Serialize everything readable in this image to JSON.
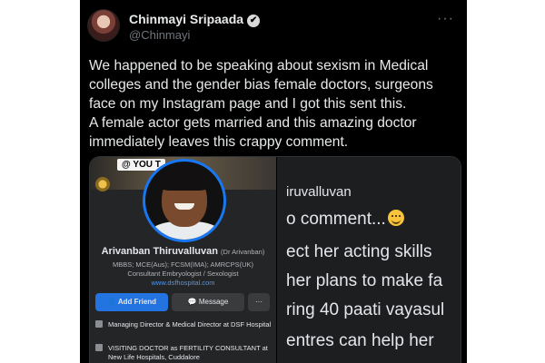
{
  "tweet": {
    "author_name": "Chinmayi Sripaada",
    "verified_badge": "✔",
    "handle": "@Chinmayi",
    "more_label": "···",
    "text": [
      "We happened to be speaking about sexism in Medical colleges and the gender bias female doctors, surgeons face on my Instagram page and I got this sent this.",
      "A female actor gets married and this amazing doctor immediately leaves this crappy comment."
    ]
  },
  "screenshot_left": {
    "tag": "@ YOU T",
    "profile_name": "Arivanban Thiruvalluvan",
    "profile_alt_name": "(Dr Arivanban)",
    "qualifications_line1": "MBBS; MCE(Aus); FCSM(IMA); AMRCPS(UK)",
    "qualifications_line2": "Consultant Embryologist / Sexologist",
    "website": "www.dsfhospital.com",
    "add_friend_label": "Add Friend",
    "message_label": "Message",
    "more_label": "···",
    "info": [
      "Managing Director & Medical Director at DSF Hospital",
      "VISITING DOCTOR as FERTILITY CONSULTANT at New Life Hospitals, Cuddalore"
    ]
  },
  "screenshot_right": {
    "lines": [
      "iruvalluvan",
      "o comment...",
      "ect her acting skills",
      "her plans to make fa",
      "ring 40 paati vayasul",
      "entres can help her"
    ]
  }
}
